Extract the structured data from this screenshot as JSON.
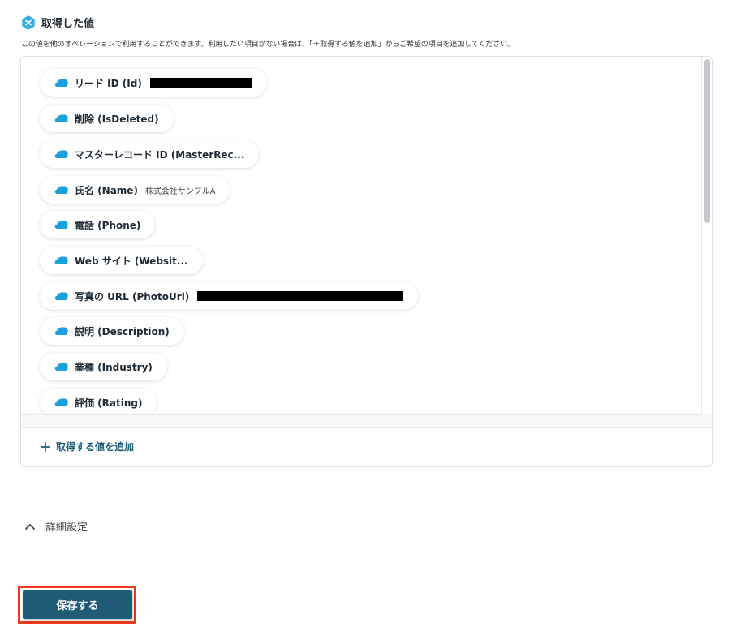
{
  "section": {
    "title": "取得した値",
    "description": "この値を他のオペレーションで利用することができます。利用したい項目がない場合は、「＋取得する値を追加」からご希望の項目を追加してください。"
  },
  "fields": [
    {
      "label": "リード ID (Id)",
      "value": "",
      "redacted": true
    },
    {
      "label": "削除 (IsDeleted)",
      "value": ""
    },
    {
      "label": "マスターレコード ID (MasterRec...",
      "value": ""
    },
    {
      "label": "氏名 (Name)",
      "value": "株式会社サンプルA"
    },
    {
      "label": "電話 (Phone)",
      "value": ""
    },
    {
      "label": "Web サイト (Websit...",
      "value": ""
    },
    {
      "label": "写真の URL (PhotoUrl)",
      "value": "",
      "redacted": true
    },
    {
      "label": "説明 (Description)",
      "value": ""
    },
    {
      "label": "業種 (Industry)",
      "value": ""
    },
    {
      "label": "評価 (Rating)",
      "value": ""
    }
  ],
  "add_value_label": "取得する値を追加",
  "advanced_settings_label": "詳細設定",
  "save_label": "保存する",
  "colors": {
    "accent": "#1f5b76",
    "salesforce_blue": "#1ba0db",
    "highlight": "#ee3b1e"
  }
}
